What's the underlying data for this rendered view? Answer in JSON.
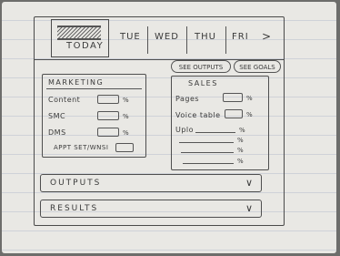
{
  "tabs": {
    "today": "TODAY",
    "tue": "TUE",
    "wed": "WED",
    "thu": "THU",
    "fri": "FRI",
    "next_icon": "chevron-right-icon"
  },
  "actions": {
    "see_outputs": "SEE OUTPUTS",
    "see_goals": "SEE GOALS"
  },
  "marketing": {
    "title": "MARKETING",
    "rows": [
      {
        "label": "Content",
        "suffix": "%"
      },
      {
        "label": "SMC",
        "suffix": "%"
      },
      {
        "label": "DMS",
        "suffix": "%"
      },
      {
        "label": "APPT SET/WNSI",
        "suffix": ""
      }
    ]
  },
  "sales": {
    "title": "SALES",
    "rows": [
      {
        "label": "Pages",
        "suffix": "%"
      },
      {
        "label": "Voice table",
        "suffix": "%"
      },
      {
        "label": "Uplo",
        "suffix": "%"
      },
      {
        "label": "",
        "suffix": "%"
      },
      {
        "label": "",
        "suffix": "%"
      },
      {
        "label": "",
        "suffix": "%"
      }
    ]
  },
  "sections": {
    "outputs": "OUTPUTS",
    "results": "RESULTS"
  }
}
